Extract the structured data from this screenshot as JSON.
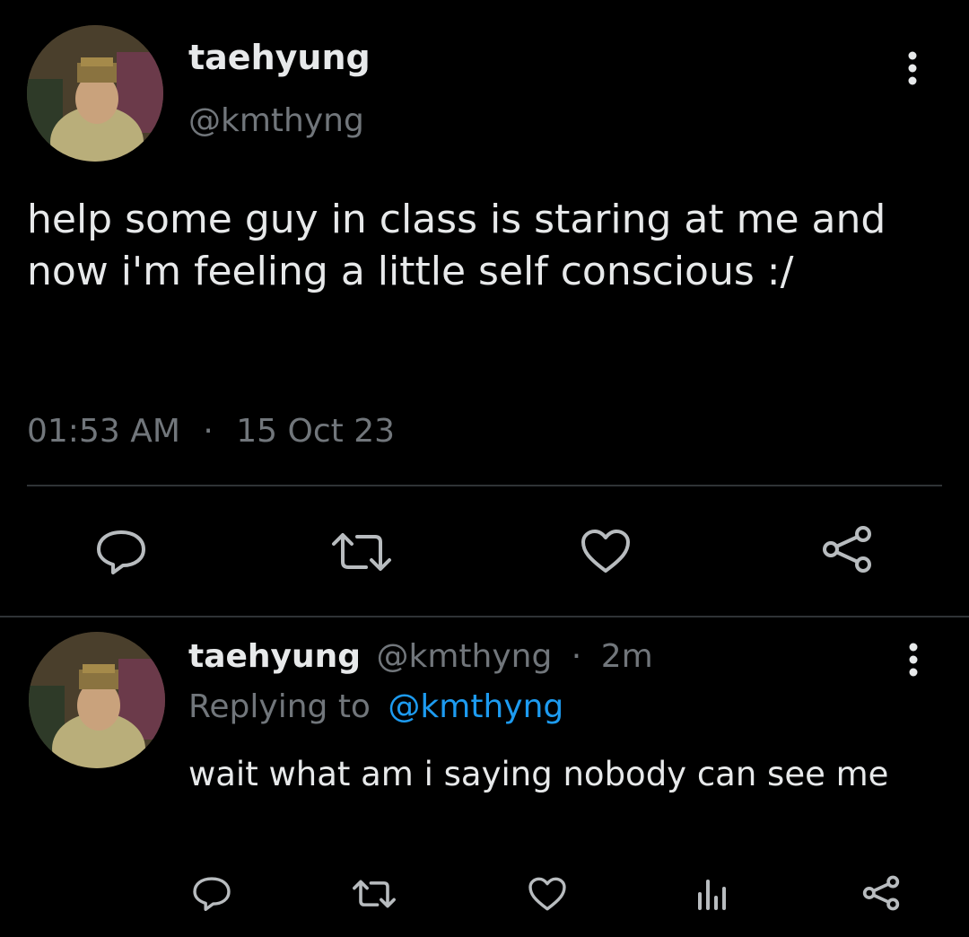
{
  "main_tweet": {
    "display_name": "taehyung",
    "handle": "@kmthyng",
    "text": "help some guy in class is staring at me and now i'm feeling a little self conscious :/",
    "time": "01:53 AM",
    "separator": "·",
    "date": "15 Oct 23",
    "actions": [
      "reply-icon",
      "retweet-icon",
      "like-icon",
      "share-icon"
    ],
    "more_icon": "more-vertical-icon"
  },
  "reply_tweet": {
    "display_name": "taehyung",
    "handle": "@kmthyng",
    "separator": "·",
    "age": "2m",
    "replying_prefix": "Replying to",
    "replying_handle": "@kmthyng",
    "text": "wait what am i saying nobody can see me",
    "actions": [
      "reply-icon",
      "retweet-icon",
      "like-icon",
      "views-icon",
      "share-icon"
    ],
    "more_icon": "more-vertical-icon"
  },
  "colors": {
    "background": "#000000",
    "text": "#e7e9ea",
    "muted": "#71767b",
    "link": "#1d9bf0",
    "divider": "#2f3336"
  }
}
